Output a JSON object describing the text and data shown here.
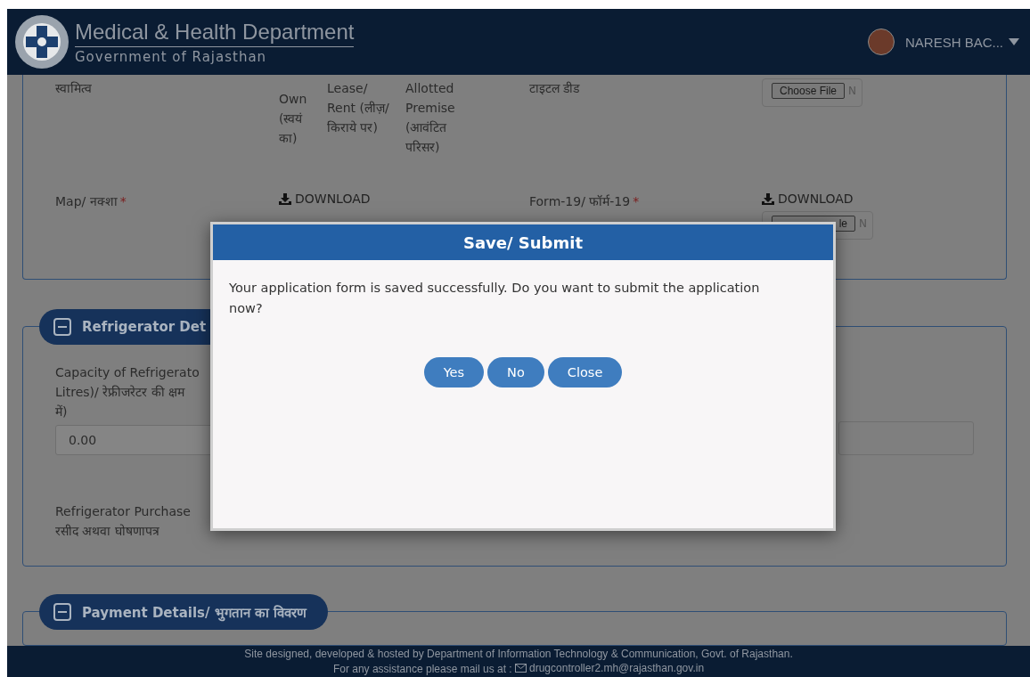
{
  "header": {
    "title": "Medical & Health Department",
    "subtitle": "Government of Rajasthan",
    "user": {
      "name": "NARESH BAC..."
    }
  },
  "ownership": {
    "label": "स्वामित्व",
    "options": [
      {
        "label": "Own (स्वयं का)"
      },
      {
        "label": "Lease/ Rent (लीज़/ किराये पर)"
      },
      {
        "label": "Allotted Premise (आवंटित परिसर)"
      }
    ],
    "deed_label": "टाइटल डीड",
    "file_button": "Choose File",
    "file_status": "N"
  },
  "documents": [
    {
      "label": "Map/ नक्शा",
      "asterisk": "*",
      "download": "DOWNLOAD"
    },
    {
      "label": "Form-19/ फॉर्म-19",
      "asterisk": "*",
      "download": "DOWNLOAD",
      "file_button": "le",
      "file_status": "N"
    }
  ],
  "refrigerator": {
    "legend": "Refrigerator Det",
    "capacity_label": [
      "Capacity of Refrigerato",
      "Litres)/ रेफ्रीजरेटर की क्षम",
      "में)"
    ],
    "capacity_value": "0.00",
    "purchase_label": [
      "Refrigerator Purchase",
      "रसीद अथवा घोषणापत्र"
    ]
  },
  "payment": {
    "legend": "Payment Details/ भुगतान का विवरण"
  },
  "dialog": {
    "title": "Save/ Submit",
    "message": "Your application form is saved successfully. Do you want to submit the application now?",
    "buttons": [
      "Yes",
      "No",
      "Close"
    ]
  },
  "footer": {
    "credit": "Site designed, developed & hosted by Department of Information Technology & Communication, Govt. of Rajasthan.",
    "assist": "For any assistance please mail us at :",
    "email": "drugcontroller2.mh@rajasthan.gov.in"
  }
}
